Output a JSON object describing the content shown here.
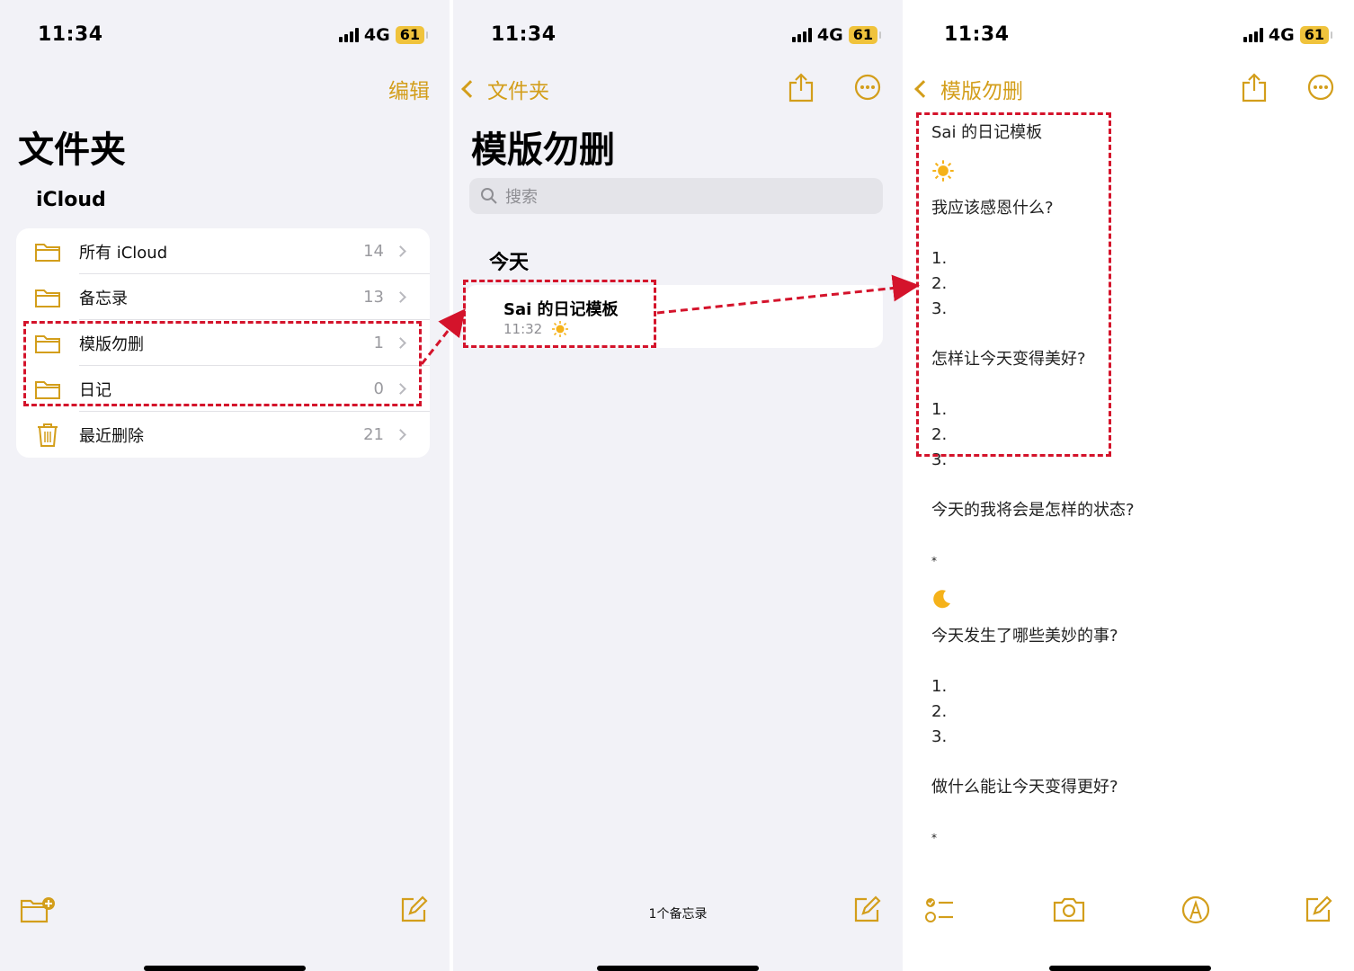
{
  "status": {
    "time": "11:34",
    "network": "4G",
    "battery": "61"
  },
  "folders_screen": {
    "edit_label": "编辑",
    "title": "文件夹",
    "section": "iCloud",
    "folders": [
      {
        "name": "所有 iCloud",
        "count": "14",
        "icon": "folder-icon"
      },
      {
        "name": "备忘录",
        "count": "13",
        "icon": "folder-icon"
      },
      {
        "name": "模版勿删",
        "count": "1",
        "icon": "folder-icon"
      },
      {
        "name": "日记",
        "count": "0",
        "icon": "folder-icon"
      },
      {
        "name": "最近删除",
        "count": "21",
        "icon": "trash-icon"
      }
    ]
  },
  "list_screen": {
    "back_label": "文件夹",
    "title": "模版勿删",
    "search_placeholder": "搜索",
    "section": "今天",
    "note": {
      "title": "Sai 的日记模板",
      "time": "11:32"
    },
    "footer": "1个备忘录"
  },
  "note_screen": {
    "back_label": "模版勿删",
    "lines": [
      "Sai 的日记模板",
      "",
      "我应该感恩什么?",
      "",
      "1.",
      "2.",
      "3.",
      "",
      "怎样让今天变得美好?",
      "",
      "1.",
      "2.",
      "3.",
      "",
      "今天的我将会是怎样的状态?",
      "",
      "*",
      "",
      "今天发生了哪些美妙的事?",
      "",
      "1.",
      "2.",
      "3.",
      "",
      "做什么能让今天变得更好?",
      "",
      "*"
    ]
  },
  "colors": {
    "accent": "#d39e1b",
    "highlight": "#d4132b",
    "battery": "#f0c33c"
  }
}
